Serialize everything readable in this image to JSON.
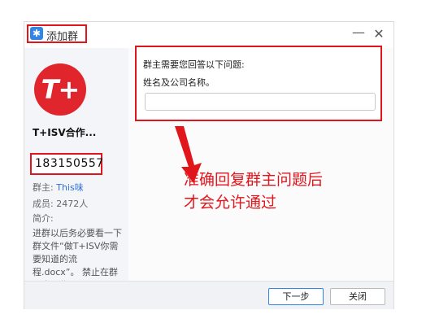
{
  "window": {
    "title": "添加群",
    "app_icon": "qq-star-icon",
    "minimize_glyph": "—",
    "close_glyph": "✕"
  },
  "group": {
    "avatar_text": "T+",
    "name": "T+ISV合作...",
    "id": "183150557",
    "owner_label": "群主:",
    "owner_value": "This味",
    "members_label": "成员:",
    "members_value": "2472人",
    "intro_label": "简介:",
    "intro_text": "进群以后务必要看一下群文件“做T+ISV你需要知道的流程.docx”。 禁止在群里发一些与二开"
  },
  "question": {
    "line1": "群主需要您回答以下问题:",
    "line2": "姓名及公司名称。",
    "answer_value": ""
  },
  "annotation": {
    "line1": "准确回复群主问题后",
    "line2": "才会允许通过"
  },
  "buttons": {
    "next": "下一步",
    "close": "关闭"
  },
  "colors": {
    "highlight_red": "#e1161c",
    "accent_blue": "#2f86e8",
    "avatar_red": "#e0262c"
  }
}
